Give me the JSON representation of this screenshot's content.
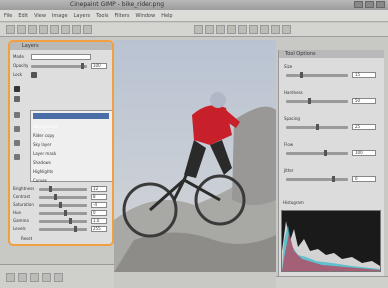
{
  "window": {
    "title": "Cinepaint GIMP - bike_rider.png"
  },
  "menubar": {
    "items": [
      "File",
      "Edit",
      "View",
      "Image",
      "Layers",
      "Tools",
      "Filters",
      "Window",
      "Help"
    ]
  },
  "toolbar": {
    "tools": [
      "new",
      "open",
      "save",
      "undo",
      "redo",
      "cut",
      "copy",
      "paste",
      "select",
      "move",
      "crop",
      "brush",
      "pencil",
      "eraser",
      "fill",
      "text",
      "zoom"
    ]
  },
  "left_panel": {
    "title": "Layers",
    "mode_label": "Mode",
    "opacity_label": "Opacity",
    "opacity_value": "100",
    "lock_label": "Lock",
    "layers": [
      "Background",
      "Rider copy",
      "Sky layer",
      "Layer mask",
      "Shadows",
      "Highlights",
      "Curves"
    ],
    "selected_layer_index": 0,
    "sliders": [
      {
        "label": "Brightness",
        "value": "12"
      },
      {
        "label": "Contrast",
        "value": "8"
      },
      {
        "label": "Saturation",
        "value": "-4"
      },
      {
        "label": "Hue",
        "value": "0"
      },
      {
        "label": "Gamma",
        "value": "1.0"
      },
      {
        "label": "Levels",
        "value": "255"
      }
    ],
    "footer_label": "Reset"
  },
  "right_panel": {
    "title": "Tool Options",
    "rows": [
      {
        "label": "Size",
        "value": "15"
      },
      {
        "label": "Hardness",
        "value": "50"
      },
      {
        "label": "Spacing",
        "value": "25"
      },
      {
        "label": "Flow",
        "value": "100"
      },
      {
        "label": "Jitter",
        "value": "0"
      }
    ],
    "histogram_label": "Histogram"
  },
  "colors": {
    "accent": "#f0a040",
    "rider_jersey": "#c8202a"
  }
}
